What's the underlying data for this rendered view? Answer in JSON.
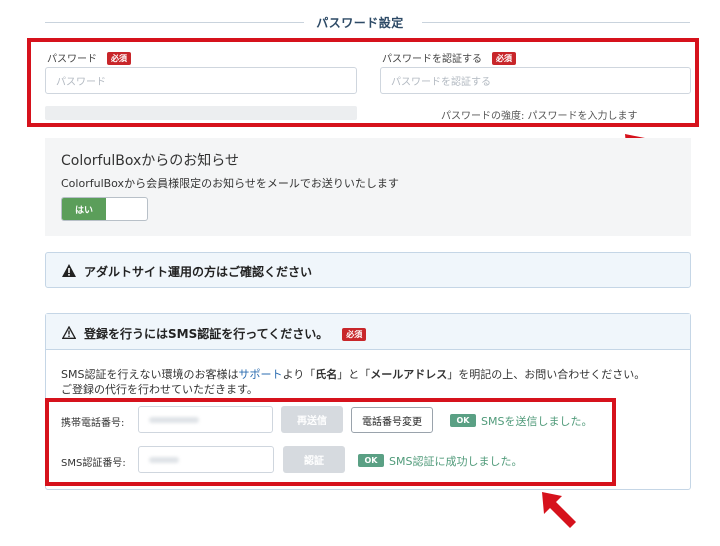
{
  "section": {
    "title": "パスワード設定"
  },
  "password": {
    "label": "パスワード",
    "required": "必須",
    "placeholder": "パスワード"
  },
  "password_confirm": {
    "label": "パスワードを認証する",
    "required": "必須",
    "placeholder": "パスワードを認証する"
  },
  "strength": {
    "text": "パスワードの強度: パスワードを入力します"
  },
  "newsletter": {
    "title": "ColorfulBoxからのお知らせ",
    "description": "ColorfulBoxから会員様限定のお知らせをメールでお送りいたします",
    "toggle_on_label": "はい"
  },
  "adult_notice": {
    "text": "アダルトサイト運用の方はご確認ください"
  },
  "sms": {
    "header": "登録を行うにはSMS認証を行ってください。",
    "required": "必須",
    "desc_part1": "SMS認証を行えない環境のお客様は",
    "desc_link": "サポート",
    "desc_part2": "より「",
    "desc_bold1": "氏名",
    "desc_part3": "」と「",
    "desc_bold2": "メールアドレス",
    "desc_part4": "」を明記の上、お問い合わせください。",
    "desc_line2": "ご登録の代行を行わせていただきます。",
    "phone_label": "携帯電話番号:",
    "resend_button": "再送信",
    "change_phone_button": "電話番号変更",
    "ok_label": "OK",
    "sent_message": "SMSを送信しました。",
    "code_label": "SMS認証番号:",
    "verify_button": "認証",
    "success_message": "SMS認証に成功しました。"
  },
  "colors": {
    "highlight": "#d6121c",
    "accent_green": "#5b9e5a",
    "ok_green": "#5aa084",
    "required_red": "#c8262a",
    "link_blue": "#2b6cb0"
  }
}
